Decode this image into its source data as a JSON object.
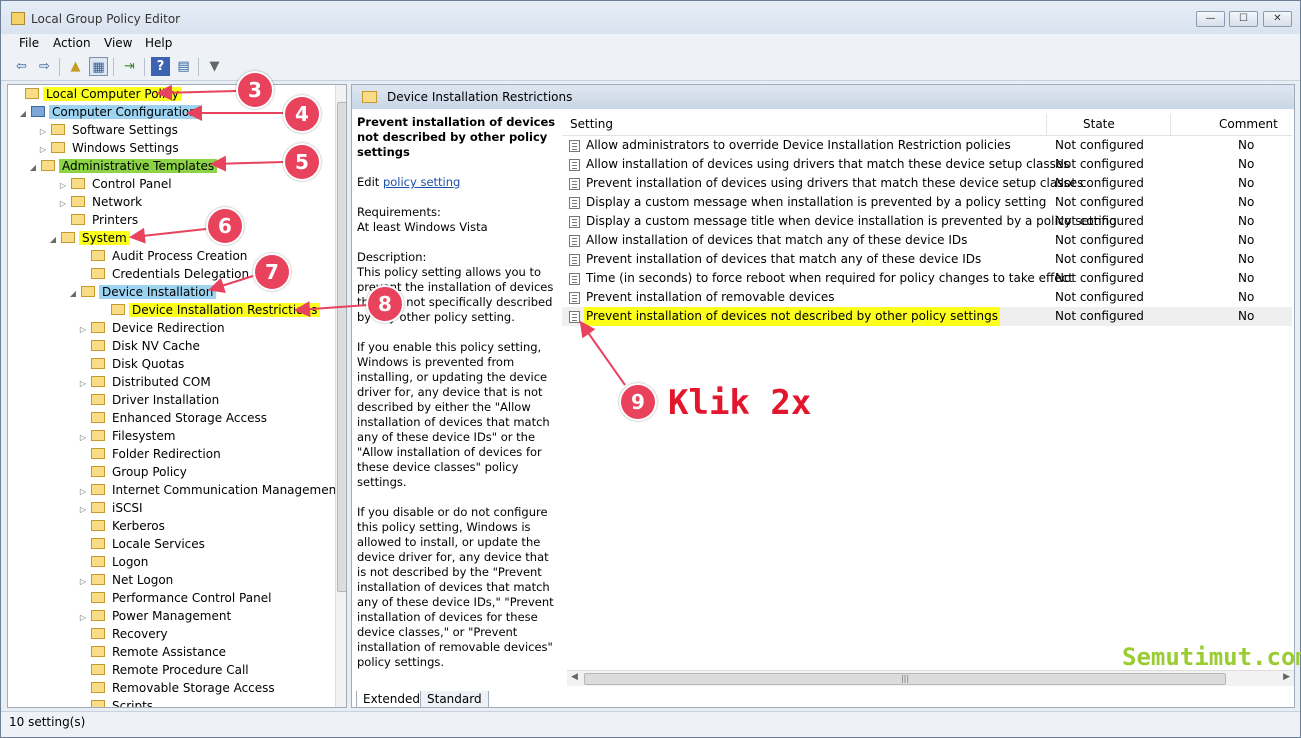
{
  "window": {
    "title": "Local Group Policy Editor",
    "min": "—",
    "max": "☐",
    "close": "✕"
  },
  "menu": [
    "File",
    "Action",
    "View",
    "Help"
  ],
  "tree": [
    {
      "label": "Local Computer Policy"
    },
    {
      "label": "Computer Configuration"
    },
    {
      "label": "Software Settings"
    },
    {
      "label": "Windows Settings"
    },
    {
      "label": "Administrative Templates"
    },
    {
      "label": "Control Panel"
    },
    {
      "label": "Network"
    },
    {
      "label": "Printers"
    },
    {
      "label": "System"
    },
    {
      "label": "Audit Process Creation"
    },
    {
      "label": "Credentials Delegation"
    },
    {
      "label": "Device Installation"
    },
    {
      "label": "Device Installation Restrictions"
    },
    {
      "label": "Device Redirection"
    },
    {
      "label": "Disk NV Cache"
    },
    {
      "label": "Disk Quotas"
    },
    {
      "label": "Distributed COM"
    },
    {
      "label": "Driver Installation"
    },
    {
      "label": "Enhanced Storage Access"
    },
    {
      "label": "Filesystem"
    },
    {
      "label": "Folder Redirection"
    },
    {
      "label": "Group Policy"
    },
    {
      "label": "Internet Communication Management"
    },
    {
      "label": "iSCSI"
    },
    {
      "label": "Kerberos"
    },
    {
      "label": "Locale Services"
    },
    {
      "label": "Logon"
    },
    {
      "label": "Net Logon"
    },
    {
      "label": "Performance Control Panel"
    },
    {
      "label": "Power Management"
    },
    {
      "label": "Recovery"
    },
    {
      "label": "Remote Assistance"
    },
    {
      "label": "Remote Procedure Call"
    },
    {
      "label": "Removable Storage Access"
    },
    {
      "label": "Scripts"
    }
  ],
  "panel": {
    "header": "Device Installation Restrictions"
  },
  "description": {
    "title": "Prevent installation of devices not described by other policy settings",
    "edit_prefix": "Edit ",
    "edit_link": "policy setting",
    "requirements_label": "Requirements:",
    "requirements_value": "At least Windows Vista",
    "description_label": "Description:",
    "para1": "This policy setting allows you to prevent the installation of devices that are not specifically described by any other policy setting.",
    "para2": "If you enable this policy setting, Windows is prevented from installing, or updating the device driver for, any device that is not described by either the \"Allow installation of devices that match any of these device IDs\" or the \"Allow installation of devices for these device classes\" policy settings.",
    "para3": "If you disable or do not configure this policy setting, Windows is allowed to install, or update the device driver for, any device that is not described by the \"Prevent installation of devices that match any of these device IDs,\" \"Prevent installation of devices for these device classes,\" or \"Prevent installation of removable devices\" policy settings."
  },
  "columns": {
    "setting": "Setting",
    "state": "State",
    "comment": "Comment"
  },
  "settings": [
    {
      "name": "Allow administrators to override Device Installation Restriction policies",
      "state": "Not configured",
      "comment": "No"
    },
    {
      "name": "Allow installation of devices using drivers that match these device setup classes",
      "state": "Not configured",
      "comment": "No"
    },
    {
      "name": "Prevent installation of devices using drivers that match these device setup classes",
      "state": "Not configured",
      "comment": "No"
    },
    {
      "name": "Display a custom message when installation is prevented by a policy setting",
      "state": "Not configured",
      "comment": "No"
    },
    {
      "name": "Display a custom message title when device installation is prevented by a policy setting",
      "state": "Not configured",
      "comment": "No"
    },
    {
      "name": "Allow installation of devices that match any of these device IDs",
      "state": "Not configured",
      "comment": "No"
    },
    {
      "name": "Prevent installation of devices that match any of these device IDs",
      "state": "Not configured",
      "comment": "No"
    },
    {
      "name": "Time (in seconds) to force reboot when required for policy changes to take effect",
      "state": "Not configured",
      "comment": "No"
    },
    {
      "name": "Prevent installation of removable devices",
      "state": "Not configured",
      "comment": "No"
    },
    {
      "name": "Prevent installation of devices not described by other policy settings",
      "state": "Not configured",
      "comment": "No"
    }
  ],
  "tabs": [
    "Extended",
    "Standard"
  ],
  "status": "10 setting(s)",
  "annotations": {
    "badges": [
      "3",
      "4",
      "5",
      "6",
      "7",
      "8",
      "9"
    ],
    "klik": "Klik 2x",
    "watermark": "Semutimut.com",
    "badge_color": "#e8425c",
    "highlight_yellow": "#fbff19"
  }
}
